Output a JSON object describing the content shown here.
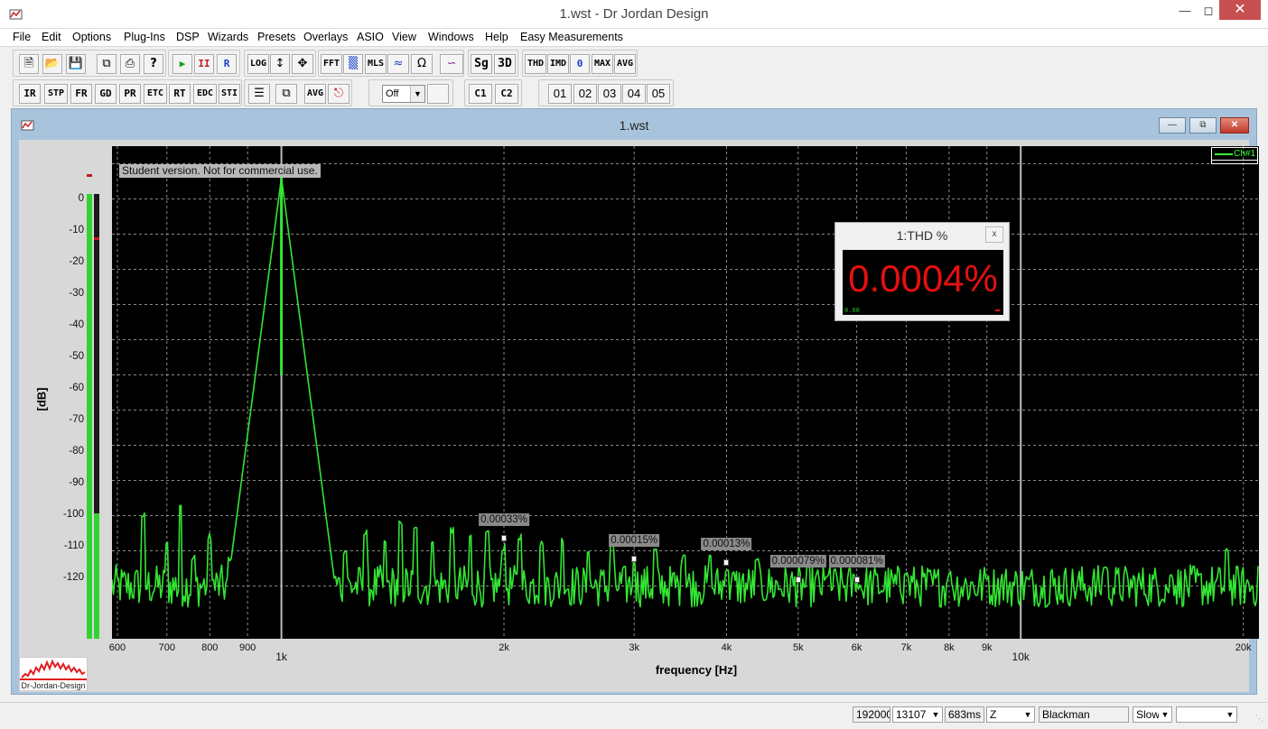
{
  "window": {
    "title": "1.wst - Dr Jordan Design"
  },
  "menu": [
    "File",
    "Edit",
    "Options",
    "Plug-Ins",
    "DSP",
    "Wizards",
    "Presets",
    "Overlays",
    "ASIO",
    "View",
    "Windows",
    "Help",
    "Easy Measurements"
  ],
  "toolbar1": {
    "fft": "FFT",
    "mls": "MLS",
    "sg": "Sg",
    "three_d": "3D",
    "thd": "THD",
    "imd": "IMD",
    "zero": "0",
    "max": "MAX",
    "avg": "AVG",
    "log": "LOG",
    "run": "▶",
    "pause": "II",
    "record": "R",
    "ohm": "Ω"
  },
  "toolbar2": {
    "ir": "IR",
    "stp": "STP",
    "fr": "FR",
    "gd": "GD",
    "pr": "PR",
    "etc": "ETC",
    "rt": "RT",
    "edc": "EDC",
    "sti": "STI",
    "avg": "AVG",
    "overlay_select": "Off",
    "c1": "C1",
    "c2": "C2",
    "presets": [
      "01",
      "02",
      "03",
      "04",
      "05"
    ]
  },
  "document": {
    "title": "1.wst",
    "watermark": "Student version. Not for commercial use.",
    "legend": "Ch#1",
    "thd_panel": {
      "title": "1:THD %",
      "value": "0.0004%",
      "scale_min": "0.00"
    },
    "logo_text": "Dr-Jordan-Design"
  },
  "chart_data": {
    "type": "line",
    "xlabel": "frequency [Hz]",
    "ylabel": "[dB]",
    "xscale": "log",
    "xlim": [
      590,
      21000
    ],
    "ylim": [
      -135,
      5
    ],
    "x_ticks": [
      {
        "label": "600",
        "value": 600,
        "major": false
      },
      {
        "label": "700",
        "value": 700,
        "major": false
      },
      {
        "label": "800",
        "value": 800,
        "major": false
      },
      {
        "label": "900",
        "value": 900,
        "major": false
      },
      {
        "label": "1k",
        "value": 1000,
        "major": true
      },
      {
        "label": "2k",
        "value": 2000,
        "major": false
      },
      {
        "label": "3k",
        "value": 3000,
        "major": false
      },
      {
        "label": "4k",
        "value": 4000,
        "major": false
      },
      {
        "label": "5k",
        "value": 5000,
        "major": false
      },
      {
        "label": "6k",
        "value": 6000,
        "major": false
      },
      {
        "label": "7k",
        "value": 7000,
        "major": false
      },
      {
        "label": "8k",
        "value": 8000,
        "major": false
      },
      {
        "label": "9k",
        "value": 9000,
        "major": false
      },
      {
        "label": "10k",
        "value": 10000,
        "major": true
      },
      {
        "label": "20k",
        "value": 20000,
        "major": false
      }
    ],
    "y_ticks": [
      0,
      -10,
      -20,
      -30,
      -40,
      -50,
      -60,
      -70,
      -80,
      -90,
      -100,
      -110,
      -120
    ],
    "grid": true,
    "legend_position": "top-right",
    "series": [
      {
        "name": "Ch#1",
        "color": "#33e633",
        "noise_floor_db": -120,
        "fundamental": {
          "x": 1000,
          "y": 0
        },
        "spurs": [
          [
            650,
            -100
          ],
          [
            700,
            -108
          ],
          [
            730,
            -97
          ],
          [
            760,
            -112
          ],
          [
            800,
            -106
          ],
          [
            850,
            -112
          ],
          [
            900,
            -105
          ],
          [
            1150,
            -112
          ],
          [
            1220,
            -110
          ],
          [
            1300,
            -105
          ],
          [
            1380,
            -108
          ],
          [
            1450,
            -102
          ],
          [
            1520,
            -104
          ],
          [
            1600,
            -107
          ],
          [
            1700,
            -104
          ],
          [
            1800,
            -106
          ],
          [
            1900,
            -105
          ],
          [
            2000,
            -109
          ],
          [
            2100,
            -106
          ],
          [
            2250,
            -108
          ],
          [
            2400,
            -107
          ],
          [
            2600,
            -110
          ],
          [
            2800,
            -108
          ],
          [
            3000,
            -113
          ],
          [
            3200,
            -110
          ],
          [
            3500,
            -111
          ],
          [
            3800,
            -112
          ],
          [
            4000,
            -115
          ],
          [
            4400,
            -113
          ],
          [
            5000,
            -121
          ],
          [
            5500,
            -117
          ],
          [
            6000,
            -121
          ],
          [
            7000,
            -116
          ],
          [
            8000,
            -117
          ],
          [
            9000,
            -118
          ],
          [
            11000,
            -116
          ],
          [
            13000,
            -115
          ],
          [
            16000,
            -117
          ],
          [
            19000,
            -110
          ]
        ]
      }
    ],
    "annotations": [
      {
        "label": "0.00033%",
        "x": 2000,
        "y": -109
      },
      {
        "label": "0.00015%",
        "x": 3000,
        "y": -115
      },
      {
        "label": "0.00013%",
        "x": 4000,
        "y": -116
      },
      {
        "label": "0.000079%",
        "x": 5000,
        "y": -121
      },
      {
        "label": "0.000081%",
        "x": 6000,
        "y": -121
      }
    ]
  },
  "level_meter": {
    "ch1_level_db": 0,
    "ch2_level_db": -101,
    "ch1_peak_db": 6,
    "ch2_peak_db": -14
  },
  "status": {
    "sample_rate": "192000",
    "fft_size": "13107",
    "duration": "683ms",
    "weighting": "Z",
    "window": "Blackman",
    "speed": "Slow",
    "extra": ""
  }
}
